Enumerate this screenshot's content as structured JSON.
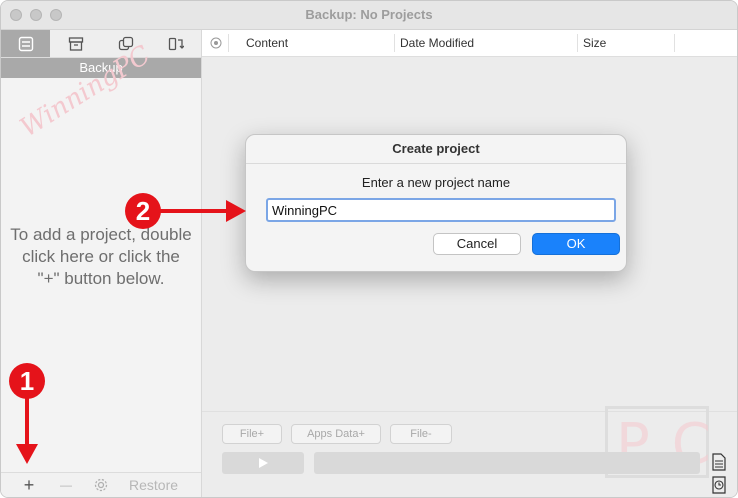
{
  "window": {
    "title": "Backup: No Projects"
  },
  "sidebar": {
    "tabs": [
      {
        "icon": "list-icon",
        "active": true
      },
      {
        "icon": "archive-box-icon",
        "active": false
      },
      {
        "icon": "duplicate-icon",
        "active": false
      },
      {
        "icon": "sync-icon",
        "active": false
      }
    ],
    "header": "Backup",
    "watermark": "WinningPC",
    "hint": "To add a project, double click here or click the \"+\" button below.",
    "footer": {
      "add_symbol": "+",
      "remove_symbol": "—",
      "restore_label": "Restore"
    }
  },
  "table": {
    "columns": [
      "Content",
      "Date Modified",
      "Size"
    ]
  },
  "bottom": {
    "buttons": [
      "File+",
      "Apps Data+",
      "File-"
    ]
  },
  "dialog": {
    "title": "Create project",
    "prompt": "Enter a new project name",
    "input_value": "WinningPC",
    "cancel_label": "Cancel",
    "ok_label": "OK"
  },
  "annotations": {
    "callout_1": "1",
    "callout_2": "2"
  },
  "logo": {
    "text": "PC"
  },
  "colors": {
    "accent": "#1a82fb",
    "callout": "#e5131a",
    "sidebar_header": "#a9a9a9"
  }
}
